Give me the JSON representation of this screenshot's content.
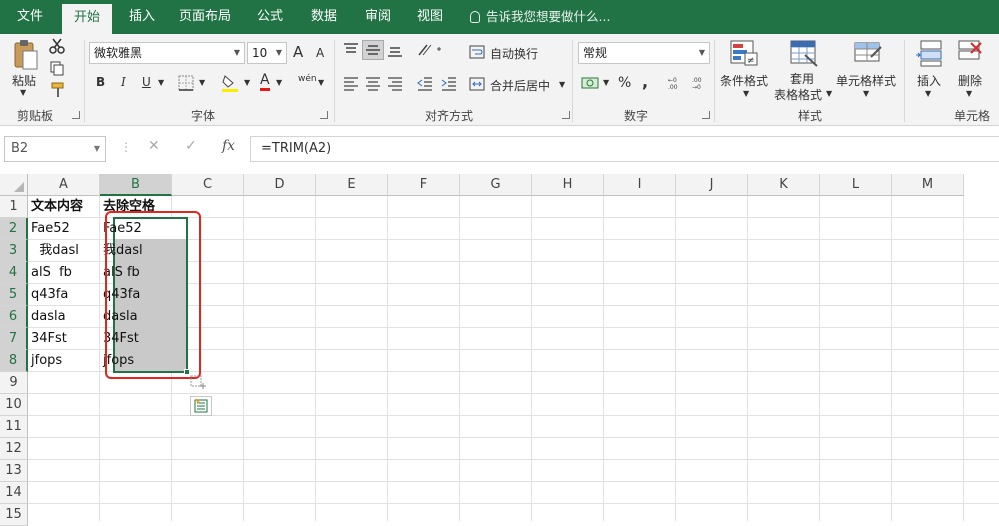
{
  "tabs": [
    "文件",
    "开始",
    "插入",
    "页面布局",
    "公式",
    "数据",
    "审阅",
    "视图"
  ],
  "tell_me": "告诉我您想要做什么...",
  "ribbon": {
    "clipboard": {
      "paste": "粘贴",
      "label": "剪贴板"
    },
    "font": {
      "name": "微软雅黑",
      "size": "10",
      "grow": "A",
      "shrink": "A",
      "bold": "B",
      "italic": "I",
      "underline": "U",
      "font_color": "A",
      "phonetic": "wén",
      "label": "字体"
    },
    "alignment": {
      "wrap": "自动换行",
      "merge": "合并后居中",
      "label": "对齐方式"
    },
    "number": {
      "format": "常规",
      "percent": "%",
      "comma": ",",
      "label": "数字"
    },
    "styles": {
      "conditional": "条件格式",
      "table_top": "套用",
      "table_bottom": "表格格式",
      "cell_styles": "单元格样式",
      "label": "样式"
    },
    "cells": {
      "insert": "插入",
      "delete": "删除",
      "label": "单元格"
    }
  },
  "formula_bar": {
    "name_box": "B2",
    "cancel": "✕",
    "enter": "✓",
    "fx": "fx",
    "formula": "=TRIM(A2)"
  },
  "columns": [
    "A",
    "B",
    "C",
    "D",
    "E",
    "F",
    "G",
    "H",
    "I",
    "J",
    "K",
    "L",
    "M"
  ],
  "rows": [
    "1",
    "2",
    "3",
    "4",
    "5",
    "6",
    "7",
    "8",
    "9",
    "10",
    "11",
    "12",
    "13",
    "14",
    "15"
  ],
  "cells_a": [
    "文本内容",
    "Fae52",
    "  我dasl",
    "alS  fb",
    "q43fa",
    "dasla",
    "34Fst",
    "jfops"
  ],
  "cells_b": [
    "去除空格",
    "Fae52",
    "我dasl",
    "alS fb",
    "q43fa",
    "dasla",
    "34Fst",
    "jfops"
  ],
  "colors": {
    "accent": "#217346",
    "highlight_box": "#e0261f",
    "selection": "#c9c9c9"
  }
}
